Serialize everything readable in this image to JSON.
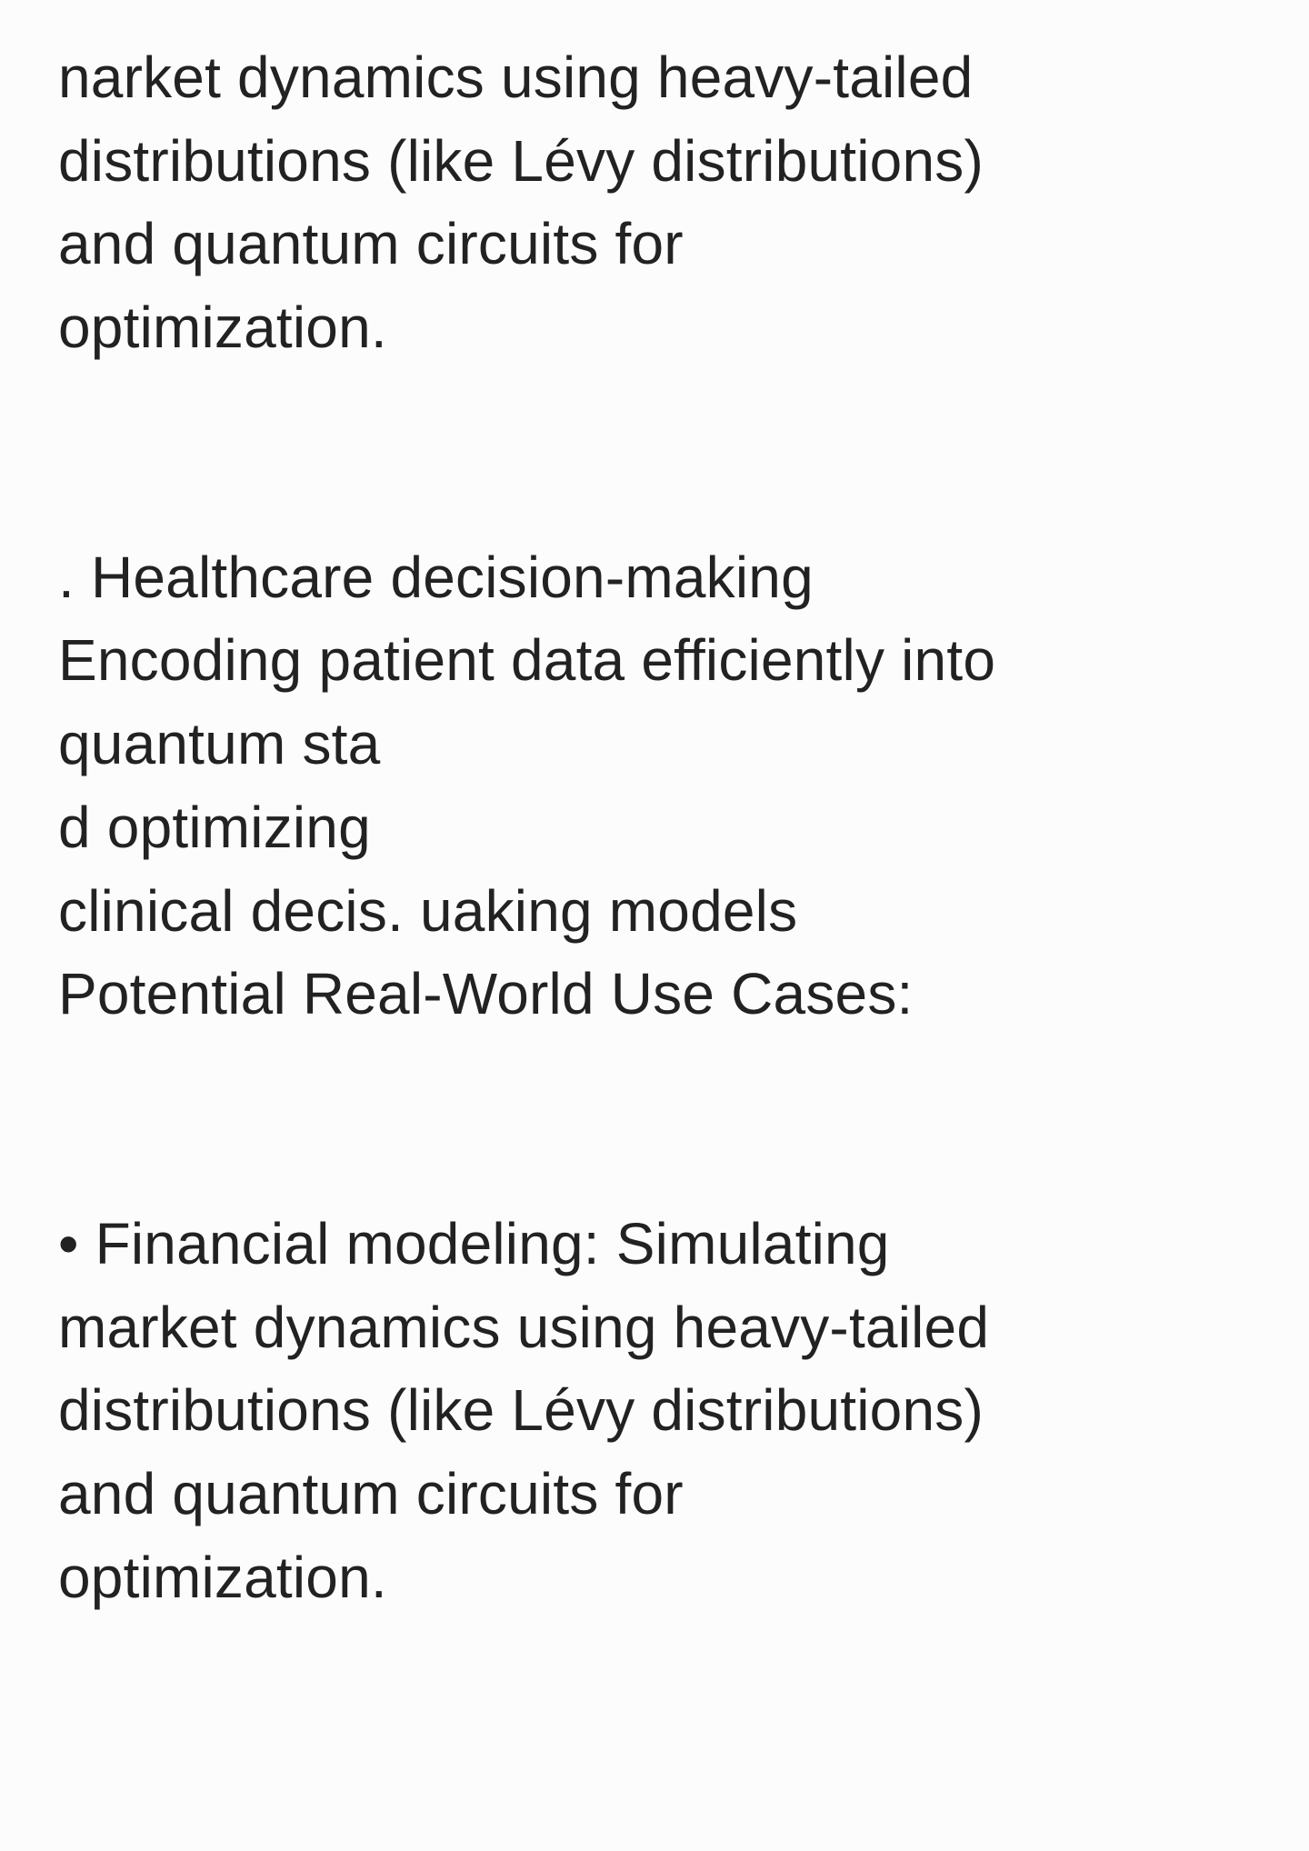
{
  "note": {
    "block1": [
      "narket dynamics using heavy-tailed",
      "distributions (like Lévy distributions)",
      "and quantum circuits for",
      "optimization."
    ],
    "block2": [
      ". Healthcare decision-making",
      "Encoding patient data efficiently into",
      "quantum sta",
      "d optimizing",
      "clinical decis. uaking models",
      "Potential Real-World Use Cases:"
    ],
    "block3": [
      "• Financial modeling: Simulating",
      "market dynamics using heavy-tailed",
      "distributions (like Lévy distributions)",
      "and quantum circuits for",
      "optimization."
    ]
  }
}
